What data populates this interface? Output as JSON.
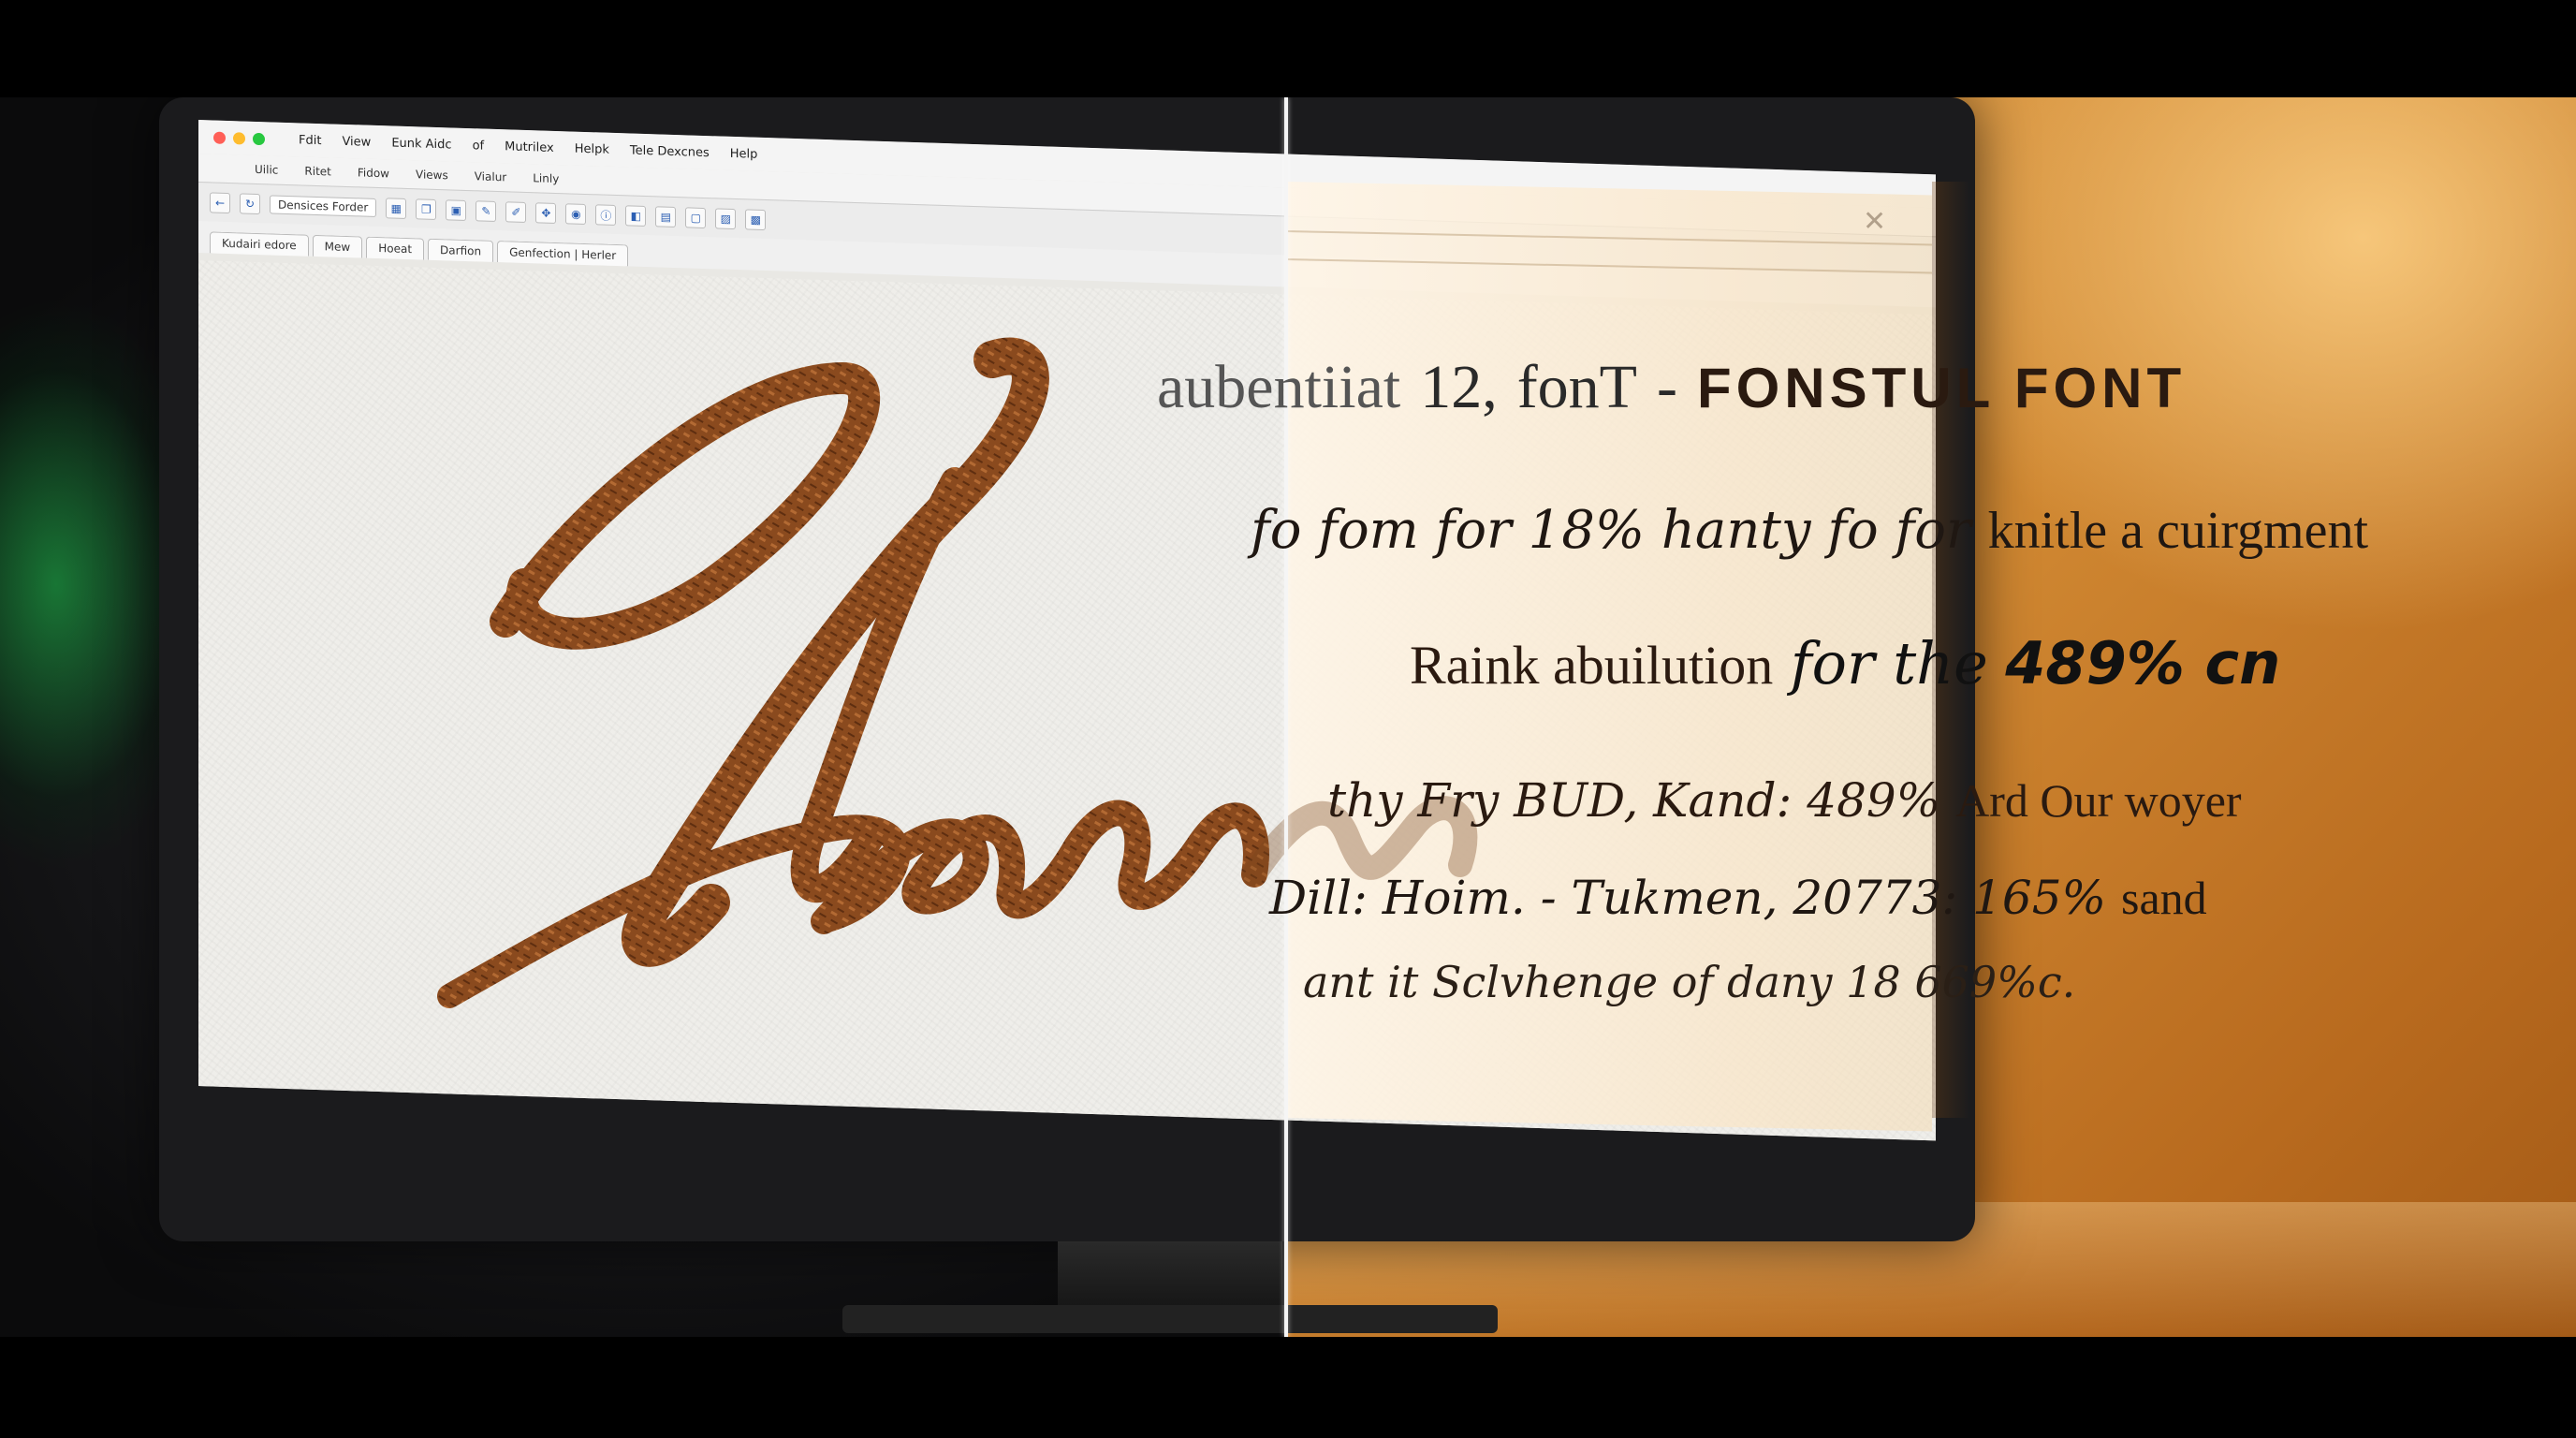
{
  "app": {
    "menubar": [
      "Fdit",
      "View",
      "Eunk Aidc",
      "of",
      "Mutrilex",
      "Helpk",
      "Tele Dexcnes",
      "Help"
    ],
    "submenu": [
      "Uilic",
      "Ritet",
      "Fidow",
      "Views",
      "Vialur",
      "Linly"
    ],
    "toolbar_field": "Densices Forder",
    "tabs": [
      "Kudairi edore",
      "Mew",
      "Hoeat",
      "Darfion",
      "Genfection | Herler"
    ]
  },
  "overlay_lines": {
    "line1": {
      "a": "aubentiiat",
      "b": "12,",
      "c": "fonT",
      "d": "-",
      "e": "FONSTUL FONT"
    },
    "line2": {
      "script": "fo fom for 18% hanty fo for",
      "serif": "knitle a cuirgment"
    },
    "line3": {
      "serif": "Raink abuilution",
      "script": "for the",
      "bold": "489% cn"
    },
    "line4": {
      "script": "thy Fry BUD, Kand: 489%",
      "serif": "Ard Our woyer"
    },
    "line5": {
      "script": "Dill: Hoim. - Tukmen, 20773: 165%",
      "serif": "sand"
    },
    "line6": {
      "script": "ant it Sclvhenge of dany 18 669%c."
    }
  },
  "colors": {
    "script_brown": "#8a4a1e",
    "warm_bg": "#d08832"
  }
}
